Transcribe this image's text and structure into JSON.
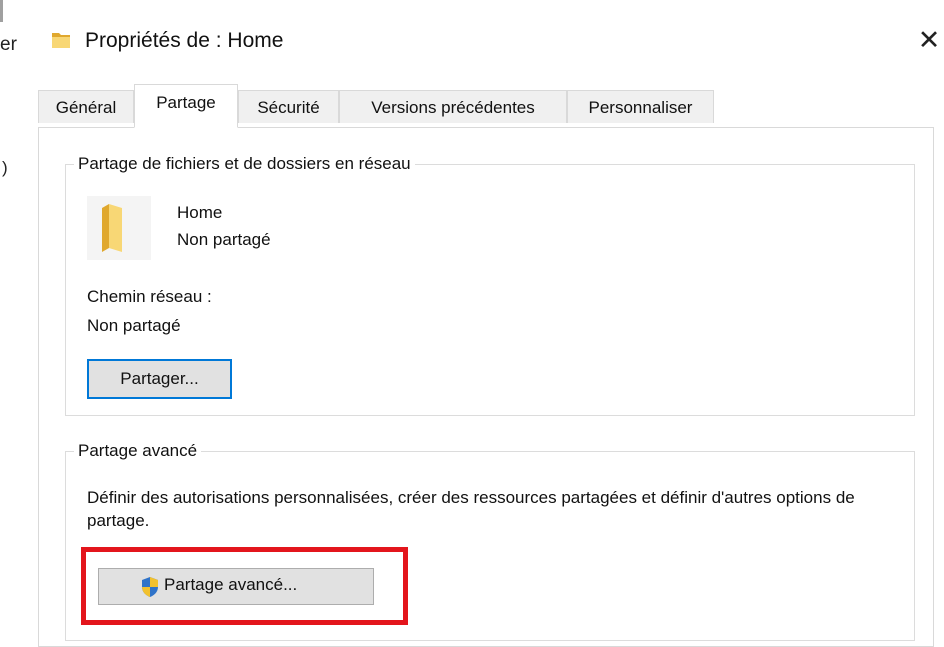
{
  "background": {
    "fragment_1": "er",
    "fragment_2": ")"
  },
  "window": {
    "title": "Propriétés de : Home",
    "close_glyph": "✕"
  },
  "tabs": [
    {
      "label": "Général",
      "active": false
    },
    {
      "label": "Partage",
      "active": true
    },
    {
      "label": "Sécurité",
      "active": false
    },
    {
      "label": "Versions précédentes",
      "active": false
    },
    {
      "label": "Personnaliser",
      "active": false
    }
  ],
  "network_sharing": {
    "group_title": "Partage de fichiers et de dossiers en réseau",
    "folder_name": "Home",
    "folder_status": "Non partagé",
    "path_label": "Chemin réseau :",
    "path_value": "Non partagé",
    "share_button": "Partager..."
  },
  "advanced_sharing": {
    "group_title": "Partage avancé",
    "description": "Définir des autorisations personnalisées, créer des ressources partagées et définir d'autres options de partage.",
    "button": "Partage avancé..."
  },
  "colors": {
    "focus_border": "#0078d7",
    "annotation_red": "#e3151c",
    "folder_yellow": "#f8d775",
    "folder_dark": "#e0a82e",
    "shield_blue": "#2f73c9",
    "shield_yellow": "#f2c12e"
  },
  "icons": {
    "title": "folder-icon",
    "large": "folder-icon",
    "button": "uac-shield-icon",
    "close": "close-icon"
  }
}
